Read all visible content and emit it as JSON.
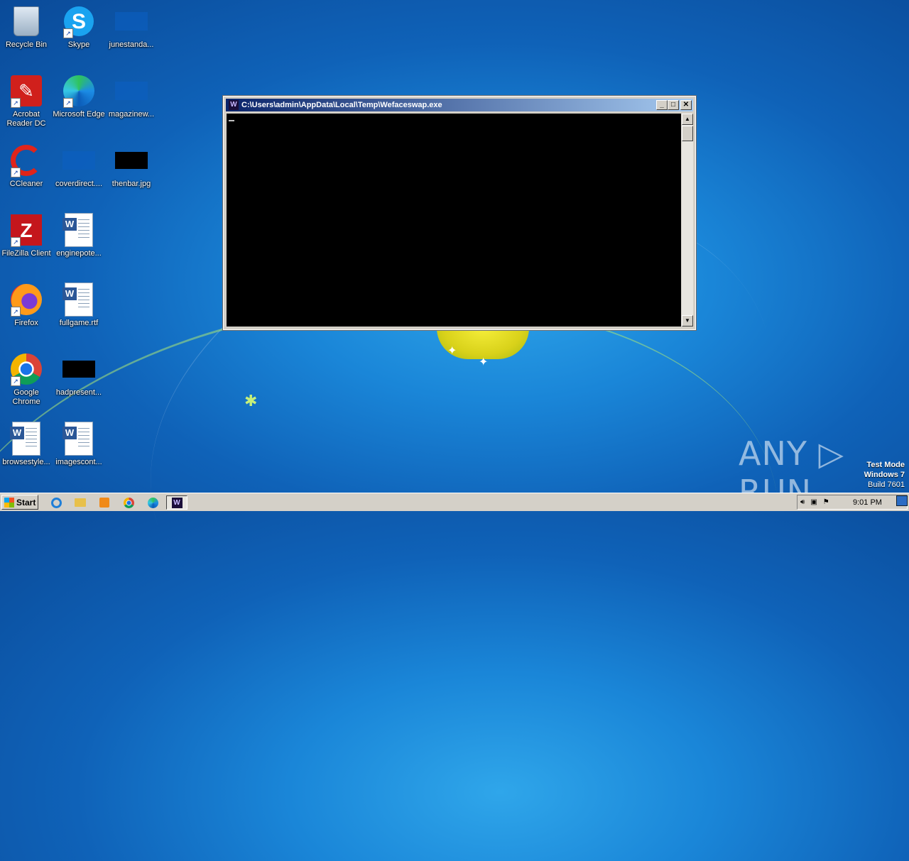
{
  "desktop": {
    "icons": [
      {
        "label": "Recycle Bin"
      },
      {
        "label": "Skype"
      },
      {
        "label": "junestanda..."
      },
      {
        "label": "Acrobat Reader DC"
      },
      {
        "label": "Microsoft Edge"
      },
      {
        "label": "magazinew..."
      },
      {
        "label": "CCleaner"
      },
      {
        "label": "coverdirect...."
      },
      {
        "label": "thenbar.jpg"
      },
      {
        "label": "FileZilla Client"
      },
      {
        "label": "enginepote..."
      },
      {
        "label": "Firefox"
      },
      {
        "label": "fullgame.rtf"
      },
      {
        "label": "Google Chrome"
      },
      {
        "label": "hadpresent..."
      },
      {
        "label": "browsestyle..."
      },
      {
        "label": "imagescont..."
      }
    ]
  },
  "window": {
    "title": "C:\\Users\\admin\\AppData\\Local\\Temp\\Wefaceswap.exe",
    "buttons": {
      "minimize": "_",
      "maximize": "□",
      "close": "✕"
    }
  },
  "watermark": {
    "brand": "ANY ▷ RUN",
    "mode": "Test Mode",
    "os": "Windows 7",
    "build": "Build 7601"
  },
  "taskbar": {
    "start_label": "Start",
    "clock": "9:01 PM"
  }
}
